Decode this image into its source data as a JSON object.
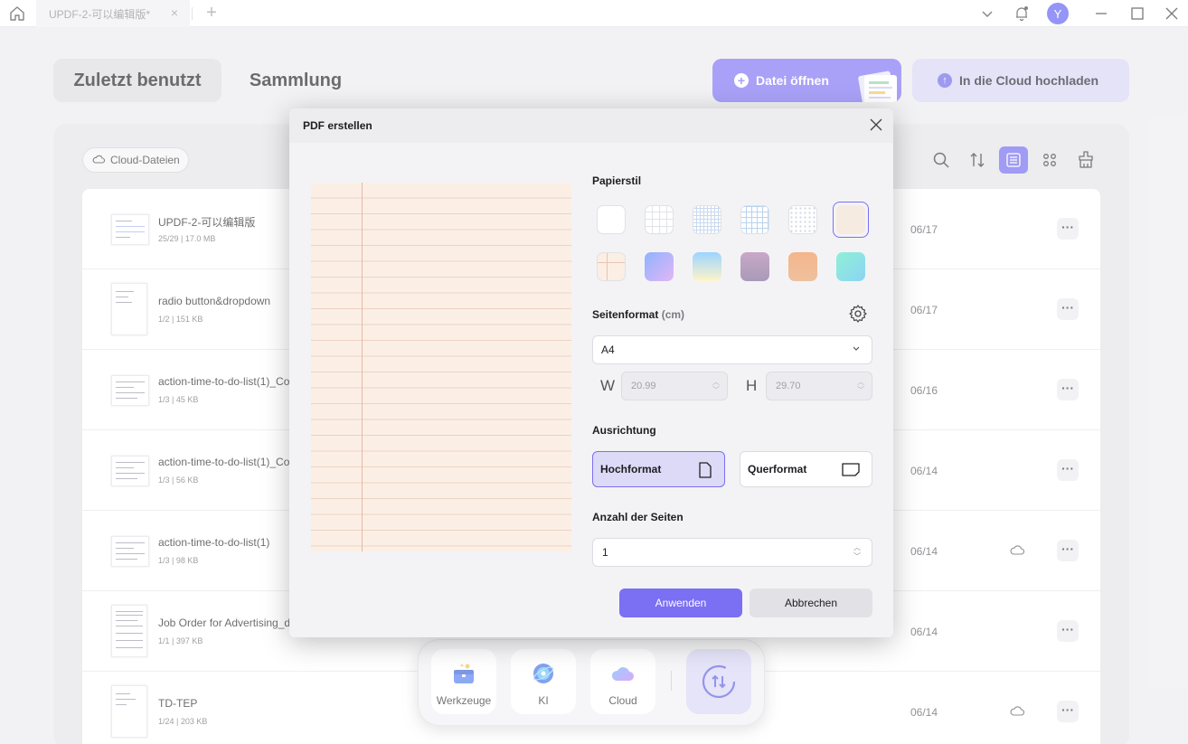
{
  "titlebar": {
    "tab_label": "UPDF-2-可以编辑版*",
    "close_glyph": "×",
    "new_tab_glyph": "+",
    "avatar_letter": "Y"
  },
  "nav": {
    "recent_label": "Zuletzt benutzt",
    "collection_label": "Sammlung",
    "open_file_label": "Datei öffnen",
    "upload_cloud_label": "In die Cloud hochladen"
  },
  "filter": {
    "cloud_files_label": "Cloud-Dateien"
  },
  "files": [
    {
      "name": "UPDF-2-可以编辑版",
      "meta": "25/29 | 17.0 MB",
      "date": "06/17",
      "cloud": false
    },
    {
      "name": "radio button&dropdown",
      "meta": "1/2 | 151 KB",
      "date": "06/17",
      "cloud": false
    },
    {
      "name": "action-time-to-do-list(1)_Co",
      "meta": "1/3 | 45 KB",
      "date": "06/16",
      "cloud": false
    },
    {
      "name": "action-time-to-do-list(1)_Co",
      "meta": "1/3 | 56 KB",
      "date": "06/14",
      "cloud": false
    },
    {
      "name": "action-time-to-do-list(1)",
      "meta": "1/3 | 98 KB",
      "date": "06/14",
      "cloud": true
    },
    {
      "name": "Job Order for Advertising_d",
      "meta": "1/1 | 397 KB",
      "date": "06/14",
      "cloud": false
    },
    {
      "name": "TD-TEP",
      "meta": "1/24 | 203 KB",
      "date": "06/14",
      "cloud": true
    }
  ],
  "more_glyph": "···",
  "dock": {
    "tools_label": "Werkzeuge",
    "ai_label": "KI",
    "cloud_label": "Cloud"
  },
  "modal": {
    "title": "PDF erstellen",
    "paper_style_label": "Papierstil",
    "page_format_label": "Seitenformat",
    "page_format_unit": "(cm)",
    "format_value": "A4",
    "width_label": "W",
    "width_value": "20.99",
    "height_label": "H",
    "height_value": "29.70",
    "orientation_label": "Ausrichtung",
    "portrait_label": "Hochformat",
    "landscape_label": "Querformat",
    "page_count_label": "Anzahl der Seiten",
    "page_count_value": "1",
    "apply_label": "Anwenden",
    "cancel_label": "Abbrechen",
    "selected_style_index": 5
  },
  "colors": {
    "accent": "#7b6ff3",
    "accent_light": "#d6d4f4",
    "paper_color": "#fbefe5"
  }
}
